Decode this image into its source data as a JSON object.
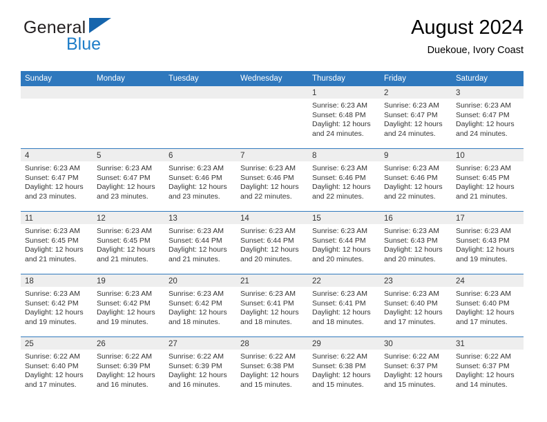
{
  "brand": {
    "name_part1": "General",
    "name_part2": "Blue"
  },
  "header": {
    "title": "August 2024",
    "subtitle": "Duekoue, Ivory Coast"
  },
  "weekdays": [
    "Sunday",
    "Monday",
    "Tuesday",
    "Wednesday",
    "Thursday",
    "Friday",
    "Saturday"
  ],
  "colors": {
    "header_blue": "#2f78bd",
    "brand_blue": "#1e7dc8",
    "flag_blue": "#1665ad",
    "day_band_gray": "#eeeeee",
    "text": "#333333"
  },
  "weeks": [
    [
      {
        "day": "",
        "empty": true
      },
      {
        "day": "",
        "empty": true
      },
      {
        "day": "",
        "empty": true
      },
      {
        "day": "",
        "empty": true
      },
      {
        "day": "1",
        "sunrise": "Sunrise: 6:23 AM",
        "sunset": "Sunset: 6:48 PM",
        "daylight": "Daylight: 12 hours and 24 minutes."
      },
      {
        "day": "2",
        "sunrise": "Sunrise: 6:23 AM",
        "sunset": "Sunset: 6:47 PM",
        "daylight": "Daylight: 12 hours and 24 minutes."
      },
      {
        "day": "3",
        "sunrise": "Sunrise: 6:23 AM",
        "sunset": "Sunset: 6:47 PM",
        "daylight": "Daylight: 12 hours and 24 minutes."
      }
    ],
    [
      {
        "day": "4",
        "sunrise": "Sunrise: 6:23 AM",
        "sunset": "Sunset: 6:47 PM",
        "daylight": "Daylight: 12 hours and 23 minutes."
      },
      {
        "day": "5",
        "sunrise": "Sunrise: 6:23 AM",
        "sunset": "Sunset: 6:47 PM",
        "daylight": "Daylight: 12 hours and 23 minutes."
      },
      {
        "day": "6",
        "sunrise": "Sunrise: 6:23 AM",
        "sunset": "Sunset: 6:46 PM",
        "daylight": "Daylight: 12 hours and 23 minutes."
      },
      {
        "day": "7",
        "sunrise": "Sunrise: 6:23 AM",
        "sunset": "Sunset: 6:46 PM",
        "daylight": "Daylight: 12 hours and 22 minutes."
      },
      {
        "day": "8",
        "sunrise": "Sunrise: 6:23 AM",
        "sunset": "Sunset: 6:46 PM",
        "daylight": "Daylight: 12 hours and 22 minutes."
      },
      {
        "day": "9",
        "sunrise": "Sunrise: 6:23 AM",
        "sunset": "Sunset: 6:46 PM",
        "daylight": "Daylight: 12 hours and 22 minutes."
      },
      {
        "day": "10",
        "sunrise": "Sunrise: 6:23 AM",
        "sunset": "Sunset: 6:45 PM",
        "daylight": "Daylight: 12 hours and 21 minutes."
      }
    ],
    [
      {
        "day": "11",
        "sunrise": "Sunrise: 6:23 AM",
        "sunset": "Sunset: 6:45 PM",
        "daylight": "Daylight: 12 hours and 21 minutes."
      },
      {
        "day": "12",
        "sunrise": "Sunrise: 6:23 AM",
        "sunset": "Sunset: 6:45 PM",
        "daylight": "Daylight: 12 hours and 21 minutes."
      },
      {
        "day": "13",
        "sunrise": "Sunrise: 6:23 AM",
        "sunset": "Sunset: 6:44 PM",
        "daylight": "Daylight: 12 hours and 21 minutes."
      },
      {
        "day": "14",
        "sunrise": "Sunrise: 6:23 AM",
        "sunset": "Sunset: 6:44 PM",
        "daylight": "Daylight: 12 hours and 20 minutes."
      },
      {
        "day": "15",
        "sunrise": "Sunrise: 6:23 AM",
        "sunset": "Sunset: 6:44 PM",
        "daylight": "Daylight: 12 hours and 20 minutes."
      },
      {
        "day": "16",
        "sunrise": "Sunrise: 6:23 AM",
        "sunset": "Sunset: 6:43 PM",
        "daylight": "Daylight: 12 hours and 20 minutes."
      },
      {
        "day": "17",
        "sunrise": "Sunrise: 6:23 AM",
        "sunset": "Sunset: 6:43 PM",
        "daylight": "Daylight: 12 hours and 19 minutes."
      }
    ],
    [
      {
        "day": "18",
        "sunrise": "Sunrise: 6:23 AM",
        "sunset": "Sunset: 6:42 PM",
        "daylight": "Daylight: 12 hours and 19 minutes."
      },
      {
        "day": "19",
        "sunrise": "Sunrise: 6:23 AM",
        "sunset": "Sunset: 6:42 PM",
        "daylight": "Daylight: 12 hours and 19 minutes."
      },
      {
        "day": "20",
        "sunrise": "Sunrise: 6:23 AM",
        "sunset": "Sunset: 6:42 PM",
        "daylight": "Daylight: 12 hours and 18 minutes."
      },
      {
        "day": "21",
        "sunrise": "Sunrise: 6:23 AM",
        "sunset": "Sunset: 6:41 PM",
        "daylight": "Daylight: 12 hours and 18 minutes."
      },
      {
        "day": "22",
        "sunrise": "Sunrise: 6:23 AM",
        "sunset": "Sunset: 6:41 PM",
        "daylight": "Daylight: 12 hours and 18 minutes."
      },
      {
        "day": "23",
        "sunrise": "Sunrise: 6:23 AM",
        "sunset": "Sunset: 6:40 PM",
        "daylight": "Daylight: 12 hours and 17 minutes."
      },
      {
        "day": "24",
        "sunrise": "Sunrise: 6:23 AM",
        "sunset": "Sunset: 6:40 PM",
        "daylight": "Daylight: 12 hours and 17 minutes."
      }
    ],
    [
      {
        "day": "25",
        "sunrise": "Sunrise: 6:22 AM",
        "sunset": "Sunset: 6:40 PM",
        "daylight": "Daylight: 12 hours and 17 minutes."
      },
      {
        "day": "26",
        "sunrise": "Sunrise: 6:22 AM",
        "sunset": "Sunset: 6:39 PM",
        "daylight": "Daylight: 12 hours and 16 minutes."
      },
      {
        "day": "27",
        "sunrise": "Sunrise: 6:22 AM",
        "sunset": "Sunset: 6:39 PM",
        "daylight": "Daylight: 12 hours and 16 minutes."
      },
      {
        "day": "28",
        "sunrise": "Sunrise: 6:22 AM",
        "sunset": "Sunset: 6:38 PM",
        "daylight": "Daylight: 12 hours and 15 minutes."
      },
      {
        "day": "29",
        "sunrise": "Sunrise: 6:22 AM",
        "sunset": "Sunset: 6:38 PM",
        "daylight": "Daylight: 12 hours and 15 minutes."
      },
      {
        "day": "30",
        "sunrise": "Sunrise: 6:22 AM",
        "sunset": "Sunset: 6:37 PM",
        "daylight": "Daylight: 12 hours and 15 minutes."
      },
      {
        "day": "31",
        "sunrise": "Sunrise: 6:22 AM",
        "sunset": "Sunset: 6:37 PM",
        "daylight": "Daylight: 12 hours and 14 minutes."
      }
    ]
  ]
}
